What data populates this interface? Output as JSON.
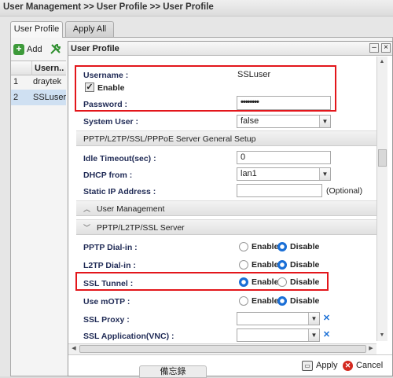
{
  "breadcrumb": "User Management >> User Profile >> User Profile",
  "tabs": [
    {
      "label": "User Profile",
      "active": true
    },
    {
      "label": "Apply All",
      "active": false
    }
  ],
  "list": {
    "add_label": "Add",
    "column_header": "Usern...",
    "rows": [
      {
        "num": "1",
        "name": "draytek",
        "selected": false
      },
      {
        "num": "2",
        "name": "SSLuser",
        "selected": true
      }
    ]
  },
  "dialog": {
    "title": "User Profile",
    "username_label": "Username :",
    "username_value": "SSLuser",
    "enable_label": "Enable",
    "enable_checked": true,
    "password_label": "Password :",
    "password_value": "••••••••",
    "system_user_label": "System User :",
    "system_user_value": "false",
    "section_pptp_general": "PPTP/L2TP/SSL/PPPoE Server General Setup",
    "idle_timeout_label": "Idle Timeout(sec) :",
    "idle_timeout_value": "0",
    "dhcp_from_label": "DHCP from :",
    "dhcp_from_value": "lan1",
    "static_ip_label": "Static IP Address :",
    "static_ip_value": "",
    "optional_text": "(Optional)",
    "section_user_mgmt": "User Management",
    "section_pptp_server": "PPTP/L2TP/SSL Server",
    "pptp_dialin_label": "PPTP Dial-in :",
    "l2tp_dialin_label": "L2TP Dial-in :",
    "ssl_tunnel_label": "SSL Tunnel :",
    "use_motp_label": "Use mOTP :",
    "ssl_proxy_label": "SSL Proxy :",
    "ssl_app_label": "SSL Application(VNC) :",
    "enable_text": "Enable",
    "disable_text": "Disable",
    "radios": {
      "pptp_dialin": "Disable",
      "l2tp_dialin": "Disable",
      "ssl_tunnel": "Enable",
      "use_motp": "Disable"
    },
    "apply_label": "Apply",
    "cancel_label": "Cancel"
  },
  "memo_tab": "備忘錄",
  "colors": {
    "highlight_box": "#e3161b",
    "radio_selected": "#1a6fd6",
    "selected_row": "#cfe0f2"
  }
}
